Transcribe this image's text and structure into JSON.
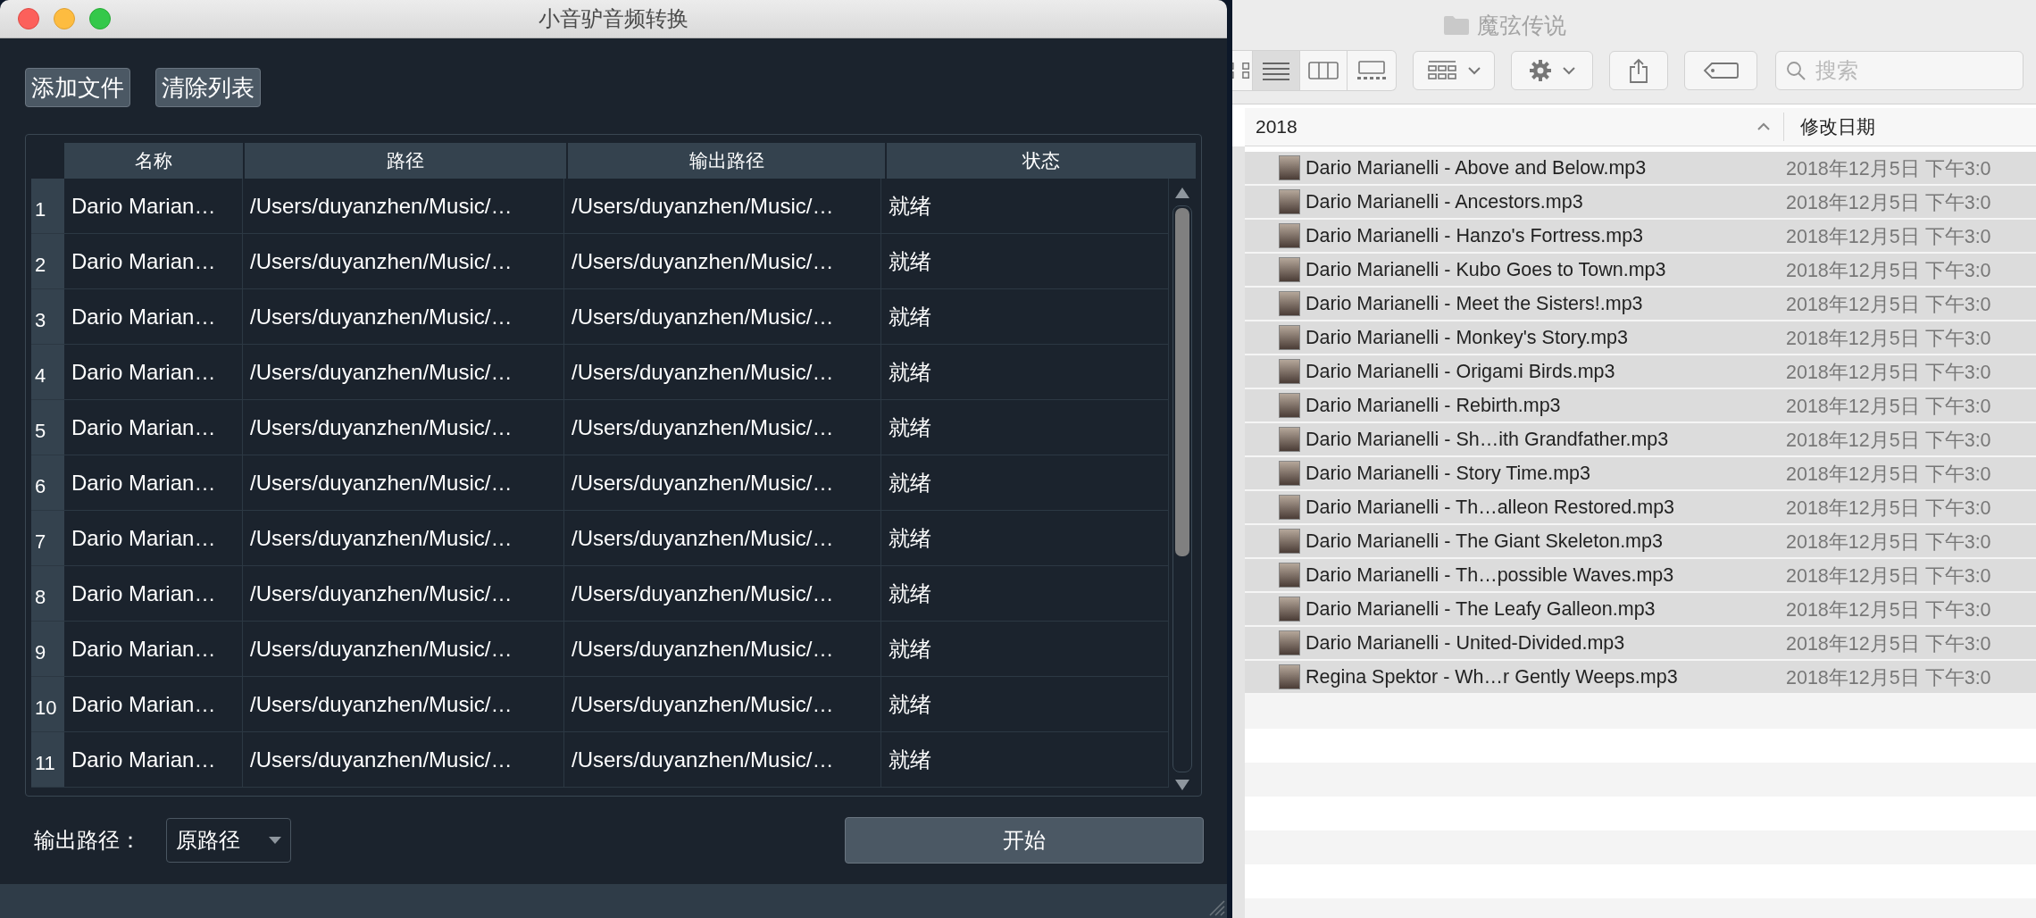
{
  "app_window": {
    "title": "小音驴音频转换",
    "buttons": [
      {
        "label": "添加文件"
      },
      {
        "label": "清除列表"
      }
    ],
    "table": {
      "columns": [
        "名称",
        "路径",
        "输出路径",
        "状态"
      ],
      "rows": [
        {
          "number": "1",
          "name": "Dario Marian…",
          "path": "/Users/duyanzhen/Music/…",
          "output_path": "/Users/duyanzhen/Music/…",
          "status": "就绪"
        },
        {
          "number": "2",
          "name": "Dario Marian…",
          "path": "/Users/duyanzhen/Music/…",
          "output_path": "/Users/duyanzhen/Music/…",
          "status": "就绪"
        },
        {
          "number": "3",
          "name": "Dario Marian…",
          "path": "/Users/duyanzhen/Music/…",
          "output_path": "/Users/duyanzhen/Music/…",
          "status": "就绪"
        },
        {
          "number": "4",
          "name": "Dario Marian…",
          "path": "/Users/duyanzhen/Music/…",
          "output_path": "/Users/duyanzhen/Music/…",
          "status": "就绪"
        },
        {
          "number": "5",
          "name": "Dario Marian…",
          "path": "/Users/duyanzhen/Music/…",
          "output_path": "/Users/duyanzhen/Music/…",
          "status": "就绪"
        },
        {
          "number": "6",
          "name": "Dario Marian…",
          "path": "/Users/duyanzhen/Music/…",
          "output_path": "/Users/duyanzhen/Music/…",
          "status": "就绪"
        },
        {
          "number": "7",
          "name": "Dario Marian…",
          "path": "/Users/duyanzhen/Music/…",
          "output_path": "/Users/duyanzhen/Music/…",
          "status": "就绪"
        },
        {
          "number": "8",
          "name": "Dario Marian…",
          "path": "/Users/duyanzhen/Music/…",
          "output_path": "/Users/duyanzhen/Music/…",
          "status": "就绪"
        },
        {
          "number": "9",
          "name": "Dario Marian…",
          "path": "/Users/duyanzhen/Music/…",
          "output_path": "/Users/duyanzhen/Music/…",
          "status": "就绪"
        },
        {
          "number": "10",
          "name": "Dario Marian…",
          "path": "/Users/duyanzhen/Music/…",
          "output_path": "/Users/duyanzhen/Music/…",
          "status": "就绪"
        },
        {
          "number": "11",
          "name": "Dario Marian…",
          "path": "/Users/duyanzhen/Music/…",
          "output_path": "/Users/duyanzhen/Music/…",
          "status": "就绪"
        }
      ]
    },
    "output_path_label": "输出路径：",
    "output_path_select": {
      "value": "原路径"
    },
    "start_button": {
      "label": "开始"
    }
  },
  "finder_window": {
    "title": "魔弦传说",
    "view_modes": [
      {
        "kind": "icons",
        "selected": false
      },
      {
        "kind": "list",
        "selected": true
      },
      {
        "kind": "columns",
        "selected": false
      },
      {
        "kind": "gallery",
        "selected": false
      }
    ],
    "search": {
      "placeholder": "搜索"
    },
    "columns": [
      "2018",
      "修改日期"
    ],
    "files": [
      {
        "name": "Dario Marianelli - Above and Below.mp3",
        "date": "2018年12月5日 下午3:0",
        "selected": true
      },
      {
        "name": "Dario Marianelli - Ancestors.mp3",
        "date": "2018年12月5日 下午3:0",
        "selected": true
      },
      {
        "name": "Dario Marianelli - Hanzo's Fortress.mp3",
        "date": "2018年12月5日 下午3:0",
        "selected": true
      },
      {
        "name": "Dario Marianelli - Kubo Goes to Town.mp3",
        "date": "2018年12月5日 下午3:0",
        "selected": true
      },
      {
        "name": "Dario Marianelli - Meet the Sisters!.mp3",
        "date": "2018年12月5日 下午3:0",
        "selected": true
      },
      {
        "name": "Dario Marianelli - Monkey's Story.mp3",
        "date": "2018年12月5日 下午3:0",
        "selected": true
      },
      {
        "name": "Dario Marianelli - Origami Birds.mp3",
        "date": "2018年12月5日 下午3:0",
        "selected": true
      },
      {
        "name": "Dario Marianelli - Rebirth.mp3",
        "date": "2018年12月5日 下午3:0",
        "selected": true
      },
      {
        "name": "Dario Marianelli - Sh…ith Grandfather.mp3",
        "date": "2018年12月5日 下午3:0",
        "selected": true
      },
      {
        "name": "Dario Marianelli - Story Time.mp3",
        "date": "2018年12月5日 下午3:0",
        "selected": true
      },
      {
        "name": "Dario Marianelli - Th…alleon Restored.mp3",
        "date": "2018年12月5日 下午3:0",
        "selected": true
      },
      {
        "name": "Dario Marianelli - The Giant Skeleton.mp3",
        "date": "2018年12月5日 下午3:0",
        "selected": true
      },
      {
        "name": "Dario Marianelli - Th…possible Waves.mp3",
        "date": "2018年12月5日 下午3:0",
        "selected": true
      },
      {
        "name": "Dario Marianelli - The Leafy Galleon.mp3",
        "date": "2018年12月5日 下午3:0",
        "selected": true
      },
      {
        "name": "Dario Marianelli - United-Divided.mp3",
        "date": "2018年12月5日 下午3:0",
        "selected": true
      },
      {
        "name": "Regina Spektor - Wh…r Gently Weeps.mp3",
        "date": "2018年12月5日 下午3:0",
        "selected": true
      }
    ]
  }
}
